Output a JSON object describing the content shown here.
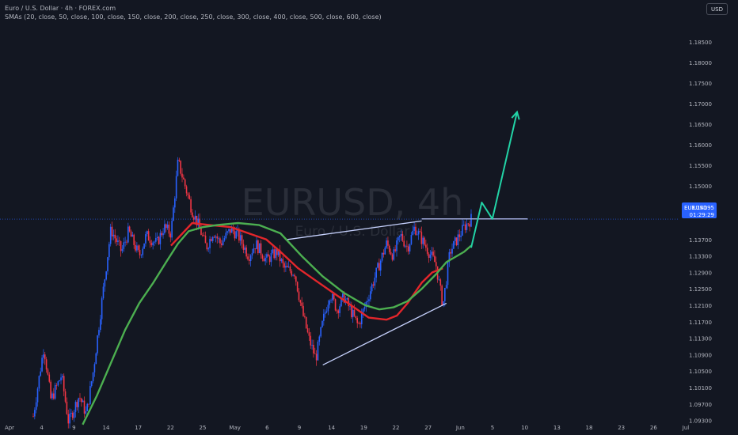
{
  "header": {
    "title": "Euro / U.S. Dollar · 4h · FOREX.com",
    "indicators": "SMAs (20, close, 50, close, 100, close, 150, close, 200, close, 250, close, 300, close, 400, close, 500, close, 600, close)",
    "currency_button": "USD"
  },
  "watermark": {
    "symbol": "EURUSD, 4h",
    "name": "Euro / U.S. Dollar"
  },
  "price_tag": {
    "symbol": "EURUSD",
    "price": "1.14195",
    "countdown": "01:29:29",
    "color": "#2962ff"
  },
  "colors": {
    "background": "#131722",
    "up_candle": "#2962ff",
    "down_candle": "#f23645",
    "sma_fast": "#e3262b",
    "sma_slow": "#4caf50",
    "trendline": "#c7d2fe",
    "projection": "#22d3a6",
    "last_price_line": "#2962ff"
  },
  "chart_data": {
    "type": "candlestick",
    "y_axis": {
      "range": [
        1.091,
        1.191
      ],
      "ticks": [
        "1.18500",
        "1.18000",
        "1.17500",
        "1.17000",
        "1.16500",
        "1.16000",
        "1.15500",
        "1.15000",
        "1.14500",
        "1.13700",
        "1.13300",
        "1.12900",
        "1.12500",
        "1.12100",
        "1.11700",
        "1.11300",
        "1.10900",
        "1.10500",
        "1.10100",
        "1.09700",
        "1.09300"
      ]
    },
    "x_axis": {
      "labels": [
        "Apr",
        "4",
        "9",
        "14",
        "17",
        "22",
        "25",
        "May",
        "6",
        "9",
        "14",
        "19",
        "22",
        "27",
        "Jun",
        "5",
        "10",
        "13",
        "18",
        "23",
        "26",
        "Jul"
      ]
    },
    "price_path": [
      [
        0,
        1.094
      ],
      [
        3,
        1.111
      ],
      [
        5,
        1.098
      ],
      [
        8,
        1.104
      ],
      [
        10,
        1.0925
      ],
      [
        13,
        1.099
      ],
      [
        15,
        1.0945
      ],
      [
        17,
        1.105
      ],
      [
        20,
        1.126
      ],
      [
        22,
        1.1395
      ],
      [
        25,
        1.134
      ],
      [
        27,
        1.139
      ],
      [
        30,
        1.133
      ],
      [
        32,
        1.138
      ],
      [
        35,
        1.136
      ],
      [
        37,
        1.14
      ],
      [
        39,
        1.1385
      ],
      [
        41,
        1.156
      ],
      [
        43,
        1.15
      ],
      [
        45,
        1.144
      ],
      [
        47,
        1.14
      ],
      [
        49,
        1.135
      ],
      [
        51,
        1.139
      ],
      [
        53,
        1.136
      ],
      [
        56,
        1.1395
      ],
      [
        58,
        1.138
      ],
      [
        61,
        1.133
      ],
      [
        63,
        1.136
      ],
      [
        66,
        1.132
      ],
      [
        69,
        1.134
      ],
      [
        71,
        1.13
      ],
      [
        74,
        1.129
      ],
      [
        76,
        1.12
      ],
      [
        78,
        1.113
      ],
      [
        80,
        1.108
      ],
      [
        82,
        1.117
      ],
      [
        84,
        1.124
      ],
      [
        86,
        1.12
      ],
      [
        88,
        1.123
      ],
      [
        90,
        1.1195
      ],
      [
        92,
        1.116
      ],
      [
        94,
        1.121
      ],
      [
        96,
        1.126
      ],
      [
        98,
        1.131
      ],
      [
        100,
        1.136
      ],
      [
        102,
        1.133
      ],
      [
        104,
        1.138
      ],
      [
        106,
        1.135
      ],
      [
        108,
        1.14
      ],
      [
        110,
        1.137
      ],
      [
        112,
        1.134
      ],
      [
        114,
        1.131
      ],
      [
        116,
        1.121
      ],
      [
        118,
        1.134
      ],
      [
        120,
        1.137
      ],
      [
        122,
        1.14
      ],
      [
        124,
        1.142
      ]
    ],
    "series": [
      {
        "type": "sma",
        "points": [
          [
            39,
            1.1355
          ],
          [
            45,
            1.141
          ],
          [
            50,
            1.1405
          ],
          [
            56,
            1.14
          ],
          [
            61,
            1.1385
          ],
          [
            66,
            1.137
          ],
          [
            70,
            1.134
          ],
          [
            75,
            1.13
          ],
          [
            80,
            1.127
          ],
          [
            85,
            1.124
          ],
          [
            90,
            1.121
          ],
          [
            95,
            1.118
          ],
          [
            100,
            1.1175
          ],
          [
            103,
            1.1185
          ],
          [
            106,
            1.1215
          ],
          [
            110,
            1.1265
          ],
          [
            113,
            1.129
          ],
          [
            116,
            1.13
          ]
        ]
      },
      {
        "type": "sma",
        "points": [
          [
            14,
            1.092
          ],
          [
            18,
            1.099
          ],
          [
            22,
            1.107
          ],
          [
            26,
            1.115
          ],
          [
            30,
            1.1215
          ],
          [
            34,
            1.1265
          ],
          [
            38,
            1.132
          ],
          [
            41,
            1.136
          ],
          [
            44,
            1.139
          ],
          [
            48,
            1.14
          ],
          [
            52,
            1.1405
          ],
          [
            58,
            1.141
          ],
          [
            64,
            1.1405
          ],
          [
            70,
            1.1385
          ],
          [
            76,
            1.133
          ],
          [
            82,
            1.128
          ],
          [
            88,
            1.124
          ],
          [
            94,
            1.121
          ],
          [
            98,
            1.12
          ],
          [
            102,
            1.1205
          ],
          [
            106,
            1.122
          ],
          [
            110,
            1.125
          ],
          [
            114,
            1.1285
          ],
          [
            117,
            1.1315
          ],
          [
            122,
            1.134
          ],
          [
            124,
            1.1355
          ]
        ]
      }
    ],
    "drawings": {
      "upper_trendline": [
        [
          72,
          1.137
        ],
        [
          110,
          1.1415
        ]
      ],
      "lower_trendline": [
        [
          82,
          1.1065
        ],
        [
          117,
          1.1215
        ]
      ],
      "resistance_line": [
        [
          110,
          1.142
        ],
        [
          140,
          1.142
        ]
      ],
      "projection_path": [
        [
          124,
          1.135
        ],
        [
          127,
          1.146
        ],
        [
          130,
          1.142
        ],
        [
          137,
          1.168
        ]
      ],
      "last_price": 1.14195
    }
  }
}
